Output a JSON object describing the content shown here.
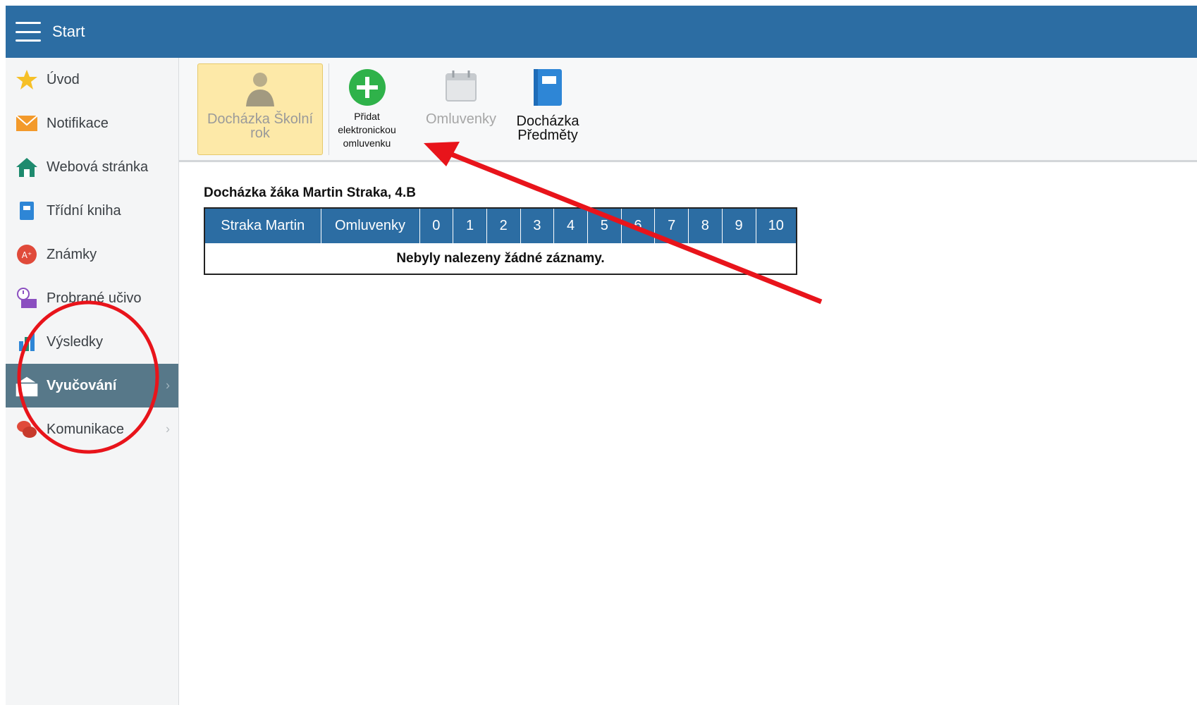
{
  "header": {
    "title": "Start"
  },
  "sidebar": {
    "items": [
      {
        "label": "Úvod"
      },
      {
        "label": "Notifikace"
      },
      {
        "label": "Webová stránka"
      },
      {
        "label": "Třídní kniha"
      },
      {
        "label": "Známky"
      },
      {
        "label": "Probrané učivo"
      },
      {
        "label": "Výsledky"
      },
      {
        "label": "Vyučování",
        "active": true
      },
      {
        "label": "Komunikace"
      }
    ]
  },
  "toolbar": {
    "dochazka_rok": "Docházka Školní rok",
    "pridat": "Přidat elektronickou omluvenku",
    "omluvenky": "Omluvenky",
    "predmety": "Docházka Předměty"
  },
  "content": {
    "title": "Docházka žáka  Martin  Straka, 4.B",
    "columns": [
      "Straka  Martin",
      "Omluvenky",
      "0",
      "1",
      "2",
      "3",
      "4",
      "5",
      "6",
      "7",
      "8",
      "9",
      "10"
    ],
    "empty_message": "Nebyly nalezeny žádné záznamy."
  },
  "colors": {
    "topbar": "#2c6da3",
    "active_nav": "#577889",
    "annotation": "#e8141b"
  }
}
